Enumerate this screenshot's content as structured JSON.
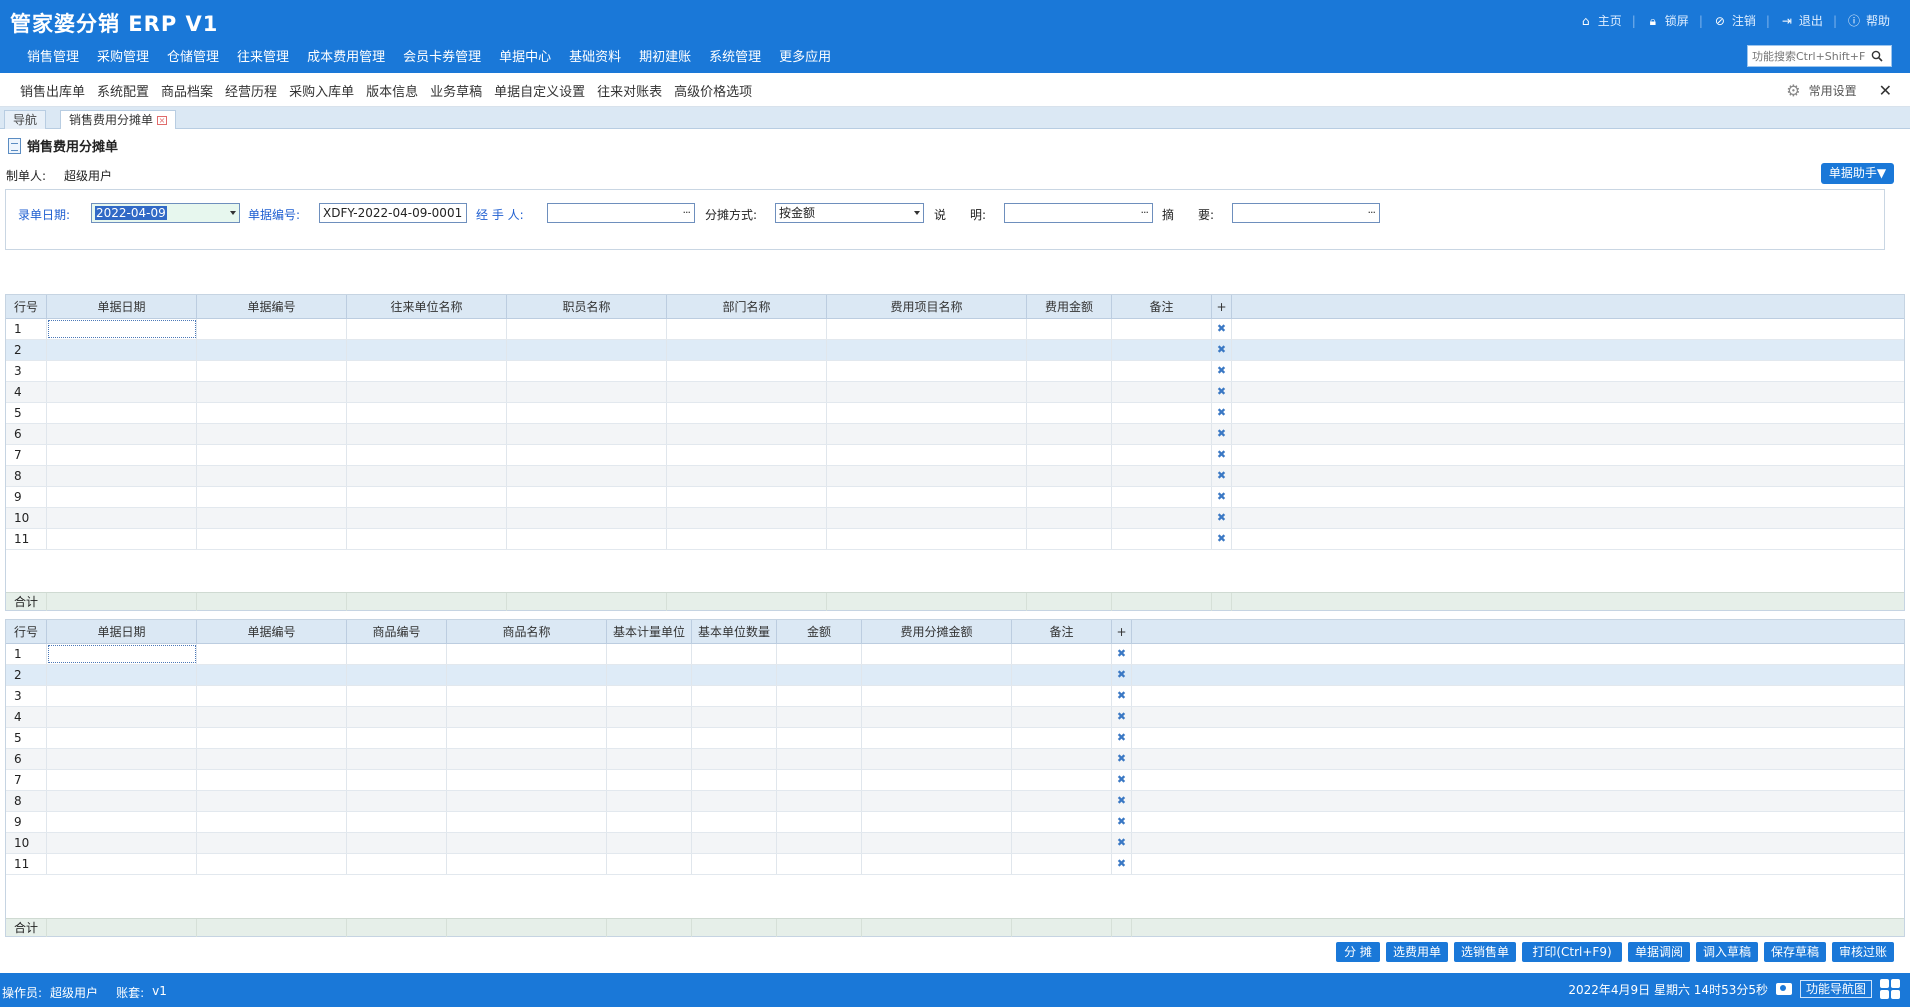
{
  "app": {
    "title": "管家婆分销 ERP V1"
  },
  "top_links": [
    {
      "label": "主页",
      "icon": "home-icon"
    },
    {
      "label": "锁屏",
      "icon": "lock-icon"
    },
    {
      "label": "注销",
      "icon": "logout-icon"
    },
    {
      "label": "退出",
      "icon": "exit-icon"
    },
    {
      "label": "帮助",
      "icon": "help-icon"
    }
  ],
  "main_nav": [
    "销售管理",
    "采购管理",
    "仓储管理",
    "往来管理",
    "成本费用管理",
    "会员卡券管理",
    "单据中心",
    "基础资料",
    "期初建账",
    "系统管理",
    "更多应用"
  ],
  "search": {
    "placeholder": "功能搜索Ctrl+Shift+F"
  },
  "quick_bar": {
    "items": [
      "销售出库单",
      "系统配置",
      "商品档案",
      "经营历程",
      "采购入库单",
      "版本信息",
      "业务草稿",
      "单据自定义设置",
      "往来对账表",
      "高级价格选项"
    ],
    "settings_label": "常用设置"
  },
  "tabs": [
    {
      "label": "导航",
      "active": false
    },
    {
      "label": "销售费用分摊单",
      "active": true
    }
  ],
  "document": {
    "title": "销售费用分摊单",
    "maker_label": "制单人:",
    "maker_value": "超级用户",
    "helper_button": "单据助手▼"
  },
  "form": {
    "date_label": "录单日期:",
    "date_value": "2022-04-09",
    "number_label": "单据编号:",
    "number_value": "XDFY-2022-04-09-0001",
    "handler_label": "经 手 人:",
    "handler_value": "",
    "method_label": "分摊方式:",
    "method_value": "按金额",
    "note_label": "说　　明:",
    "note_value": "",
    "summary_label": "摘　　要:",
    "summary_value": ""
  },
  "grid_top": {
    "columns": [
      "行号",
      "单据日期",
      "单据编号",
      "往来单位名称",
      "职员名称",
      "部门名称",
      "费用项目名称",
      "费用金额",
      "备注",
      "+"
    ],
    "rows": [
      "1",
      "2",
      "3",
      "4",
      "5",
      "6",
      "7",
      "8",
      "9",
      "10",
      "11"
    ],
    "total_label": "合计"
  },
  "grid_bottom": {
    "columns": [
      "行号",
      "单据日期",
      "单据编号",
      "商品编号",
      "商品名称",
      "基本计量单位",
      "基本单位数量",
      "金额",
      "费用分摊金额",
      "备注",
      "+"
    ],
    "rows": [
      "1",
      "2",
      "3",
      "4",
      "5",
      "6",
      "7",
      "8",
      "9",
      "10",
      "11"
    ],
    "total_label": "合计"
  },
  "actions": [
    "分 摊",
    "选费用单",
    "选销售单",
    "打印(Ctrl+F9)",
    "单据调阅",
    "调入草稿",
    "保存草稿",
    "审核过账"
  ],
  "status": {
    "operator_label": "操作员:",
    "operator_value": "超级用户",
    "account_label": "账套:",
    "account_value": "v1",
    "datetime": "2022年4月9日  星期六  14时53分5秒",
    "func_nav": "功能导航图"
  },
  "colors": {
    "primary": "#1a78d8",
    "header_bg": "#dbe8f4",
    "date_field_bg": "#e7f7ee",
    "label_blue": "#1f5fd1"
  }
}
